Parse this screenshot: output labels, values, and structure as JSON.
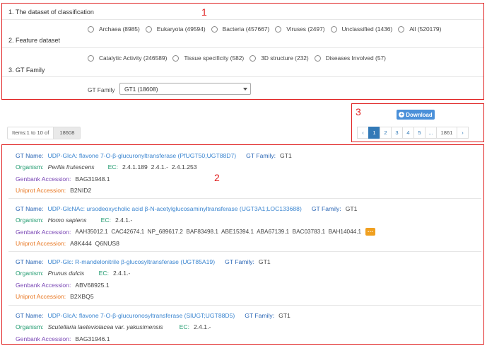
{
  "annotations": {
    "box1": "1",
    "box2": "2",
    "box3": "3"
  },
  "filters": {
    "dataset_title": "1. The dataset of classification",
    "dataset_options": [
      "Archaea (8985)",
      "Eukaryota (49594)",
      "Bacteria (457667)",
      "Viruses (2497)",
      "Unclassified (1436)",
      "All (520179)"
    ],
    "feature_title": "2. Feature dataset",
    "feature_options": [
      "Catalytic Activity (246589)",
      "Tissue specificity (582)",
      "3D structure (232)",
      "Diseases Involved (57)"
    ],
    "gt_title": "3. GT Family",
    "gt_label": "GT Family",
    "gt_selected": "GT1 (18608)"
  },
  "results_info": {
    "range": "Items:1 to 10 of",
    "total": "18608"
  },
  "toolbar": {
    "download_label": "Download",
    "download_icon": "plus-circle-icon"
  },
  "pagination": {
    "prev": "‹",
    "pages": [
      "1",
      "2",
      "3",
      "4",
      "5"
    ],
    "active": "1",
    "ellipsis": "...",
    "last": "1861",
    "next": "›"
  },
  "labels": {
    "gt_name": "GT Name:",
    "gt_family": "GT Family:",
    "organism": "Organism:",
    "ec": "EC:",
    "genbank": "Genbank Accession:",
    "uniprot": "Uniprot Accession:",
    "more": "···"
  },
  "records": [
    {
      "gt_name": "UDP-GlcA: flavone 7-O-β-glucuronyltransferase (PfUGT50;UGT88D7)",
      "gt_family": "GT1",
      "organism": "Perilla frutescens",
      "ec": "2.4.1.189  2.4.1.-  2.4.1.253",
      "genbank": "BAG31948.1",
      "uniprot": "B2NID2"
    },
    {
      "gt_name": "UDP-GlcNAc: ursodeoxycholic acid β-N-acetylglucosaminyltransferase (UGT3A1;LOC133688)",
      "gt_family": "GT1",
      "organism": "Homo sapiens",
      "ec": "2.4.1.-",
      "genbank": "AAH35012.1  CAC42674.1  NP_689617.2  BAF83498.1  ABE15394.1  ABA67139.1  BAC03783.1  BAH14044.1",
      "uniprot": "A8K444  Q6NUS8"
    },
    {
      "gt_name": "UDP-Glc: R-mandelonitrile β-glucosyltransferase (UGT85A19)",
      "gt_family": "GT1",
      "organism": "Prunus dulcis",
      "ec": "2.4.1.-",
      "genbank": "ABV68925.1",
      "uniprot": "B2XBQ5"
    },
    {
      "gt_name": "UDP-GlcA: flavone 7-O-β-glucuronosyltransferase (SlUGT;UGT88D5)",
      "gt_family": "GT1",
      "organism": "Scutellaria laeteviolacea var. yakusimensis",
      "ec": "2.4.1.-",
      "genbank": "BAG31946.1"
    }
  ]
}
